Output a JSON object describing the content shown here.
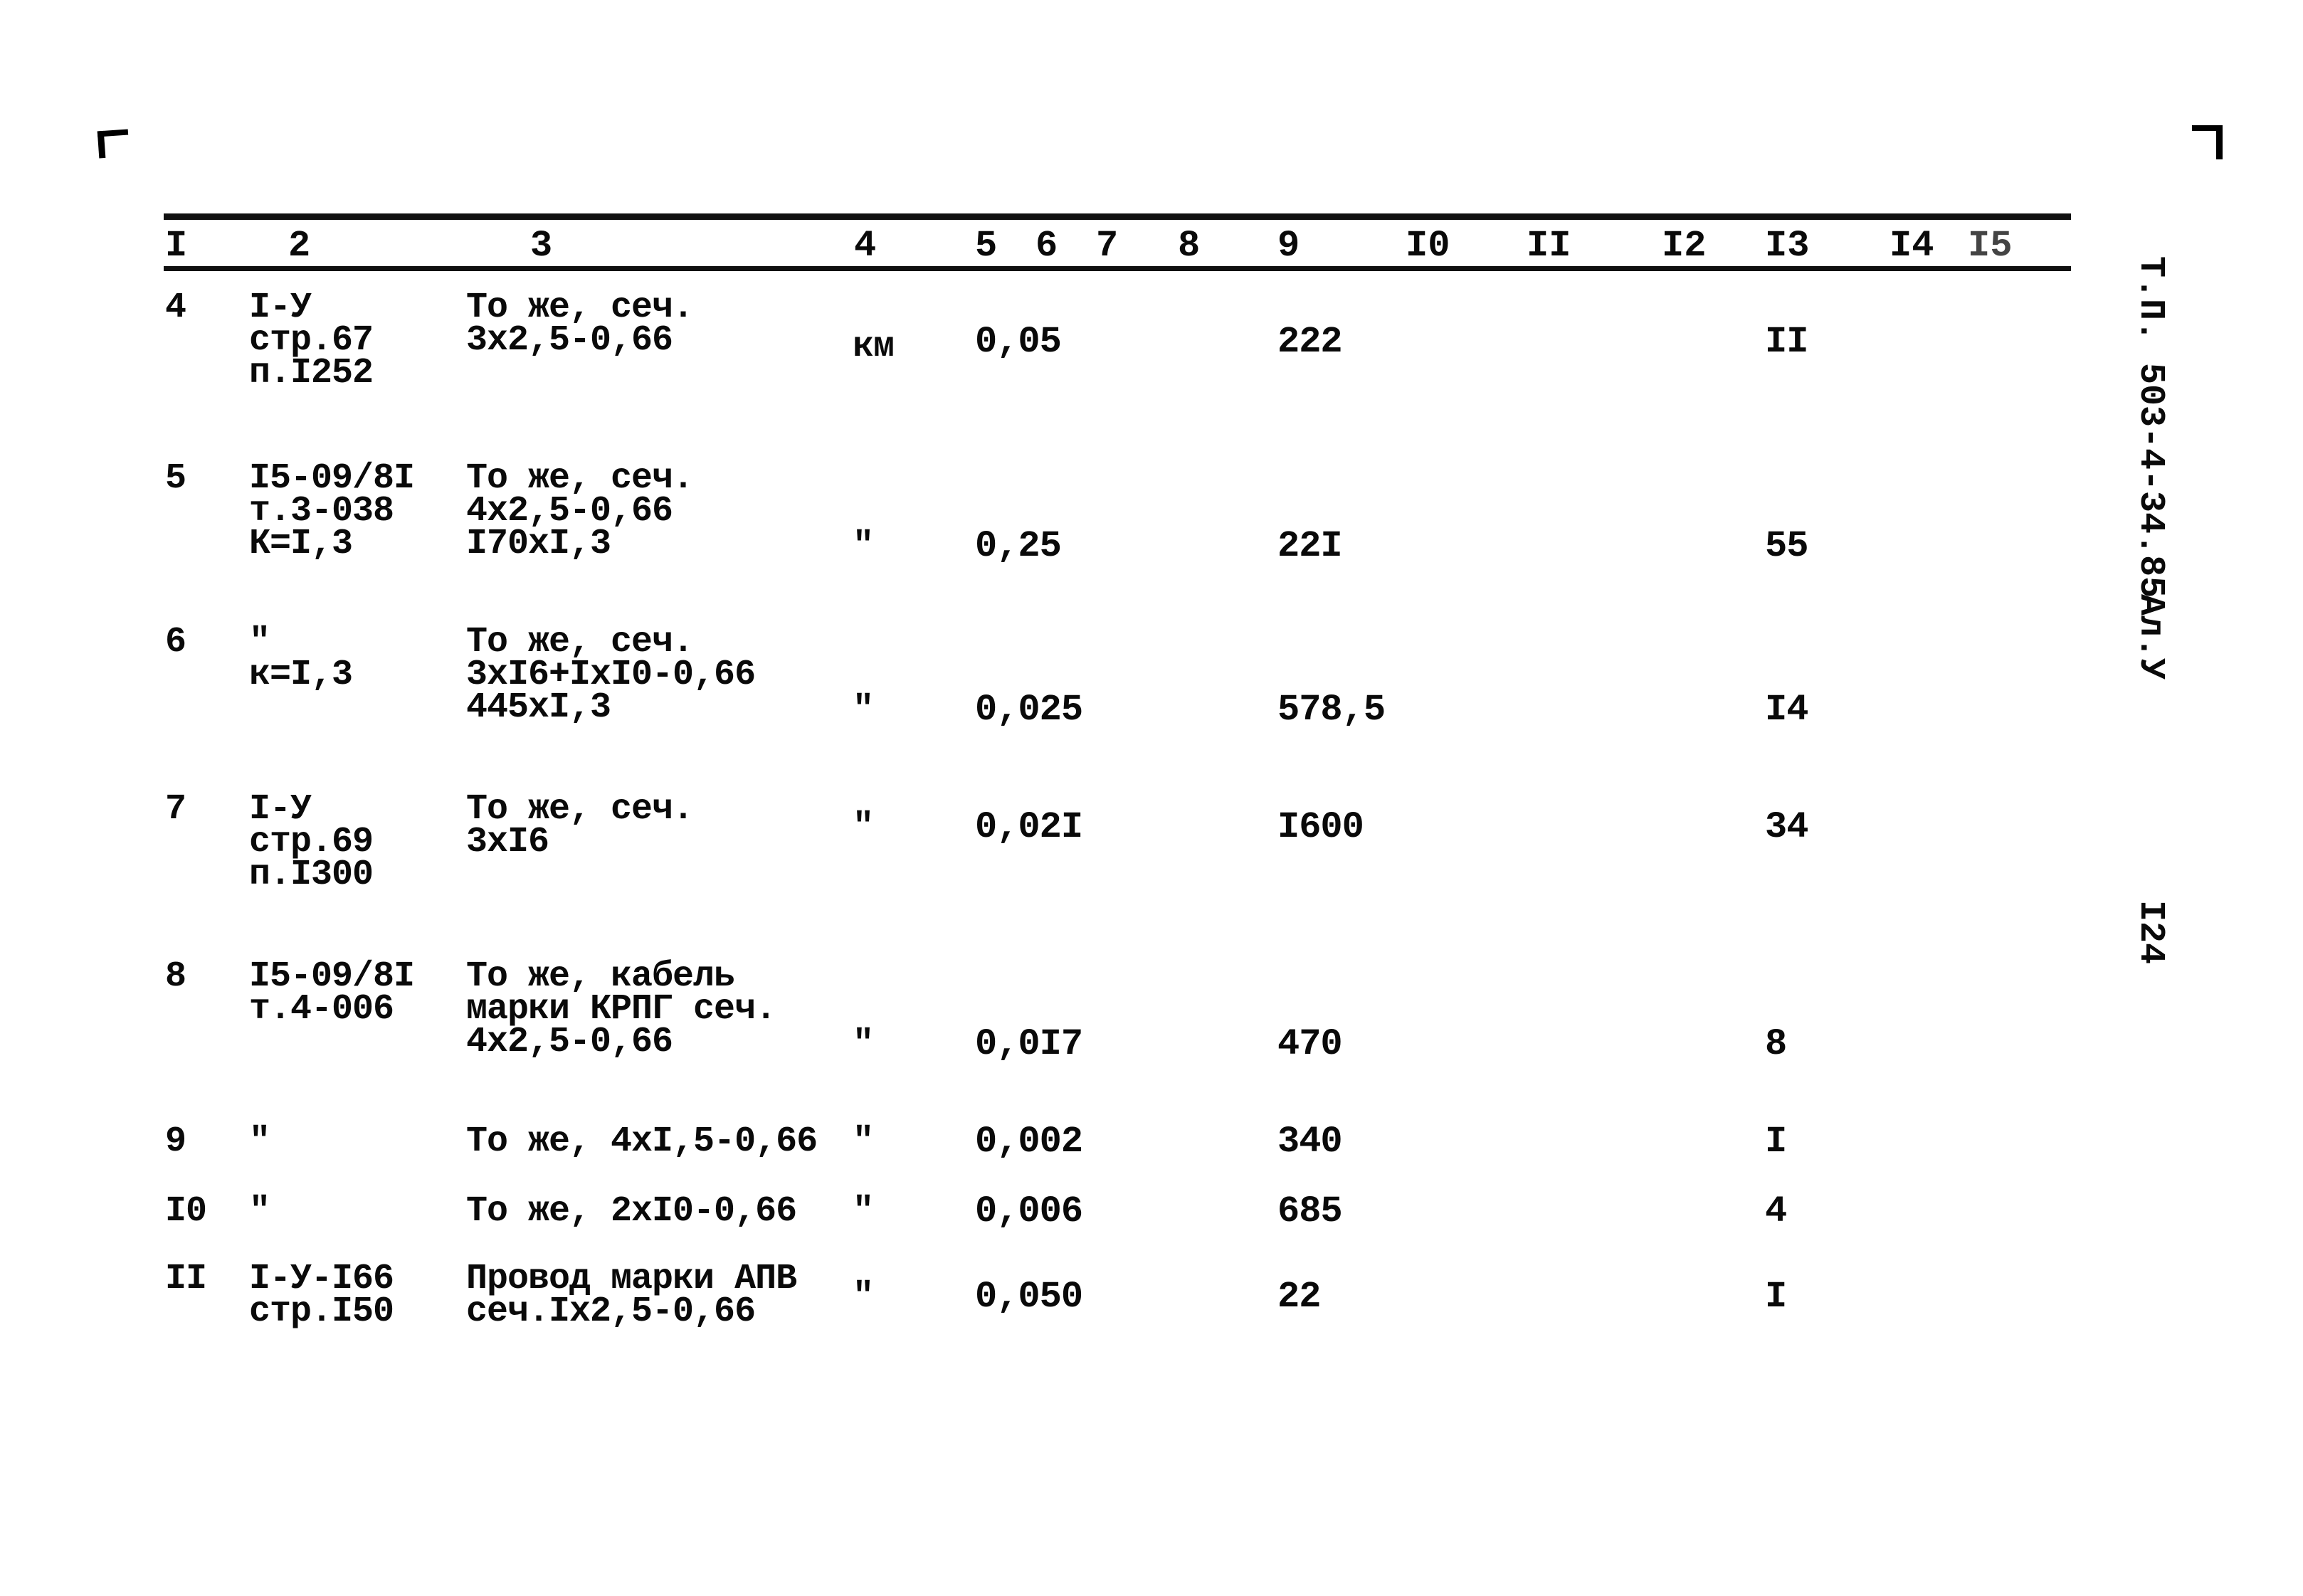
{
  "header": {
    "columns": [
      "I",
      "2",
      "3",
      "4",
      "5",
      "6",
      "7",
      "8",
      "9",
      "I0",
      "II",
      "I2",
      "I3",
      "I4",
      "I5"
    ]
  },
  "side_labels": {
    "doc_code": "Т.П. 503-4-34.85",
    "album": "Ал.У",
    "page": "I24"
  },
  "rows": [
    {
      "no": "4",
      "ref": [
        "I-У",
        "стр.67",
        "п.I252"
      ],
      "desc": [
        "То же, сеч.",
        "3х2,5-0,66"
      ],
      "unit": "км",
      "c5": "0,05",
      "c9": "222",
      "c13": "II"
    },
    {
      "no": "5",
      "ref": [
        "I5-09/8I",
        "т.3-038",
        "К=I,3"
      ],
      "desc": [
        "То же, сеч.",
        "4х2,5-0,66",
        "I70хI,3"
      ],
      "unit": "\"",
      "c5": "0,25",
      "c9": "22I",
      "c13": "55"
    },
    {
      "no": "6",
      "ref": [
        "\"",
        "к=I,3"
      ],
      "desc": [
        "То же, сеч.",
        "3хI6+IхI0-0,66",
        "445хI,3"
      ],
      "unit": "\"",
      "c5": "0,025",
      "c9": "578,5",
      "c13": "I4"
    },
    {
      "no": "7",
      "ref": [
        "I-У",
        "стр.69",
        "п.I300"
      ],
      "desc": [
        "То же, сеч.",
        "3хI6"
      ],
      "unit": "\"",
      "c5": "0,02I",
      "c9": "I600",
      "c13": "34"
    },
    {
      "no": "8",
      "ref": [
        "I5-09/8I",
        "т.4-006"
      ],
      "desc": [
        "То же, кабель",
        "марки КРПГ сеч.",
        "4х2,5-0,66"
      ],
      "unit": "\"",
      "c5": "0,0I7",
      "c9": "470",
      "c13": "8"
    },
    {
      "no": "9",
      "ref": [
        "\""
      ],
      "desc": [
        "То же, 4хI,5-0,66"
      ],
      "unit": "\"",
      "c5": "0,002",
      "c9": "340",
      "c13": "I"
    },
    {
      "no": "I0",
      "ref": [
        "\""
      ],
      "desc": [
        "То же, 2хI0-0,66"
      ],
      "unit": "\"",
      "c5": "0,006",
      "c9": "685",
      "c13": "4"
    },
    {
      "no": "II",
      "ref": [
        "I-У-I66",
        "стр.I50"
      ],
      "desc": [
        "Провод марки АПВ",
        "сеч.Iх2,5-0,66"
      ],
      "unit": "\"",
      "c5": "0,050",
      "c9": "22",
      "c13": "I"
    }
  ]
}
